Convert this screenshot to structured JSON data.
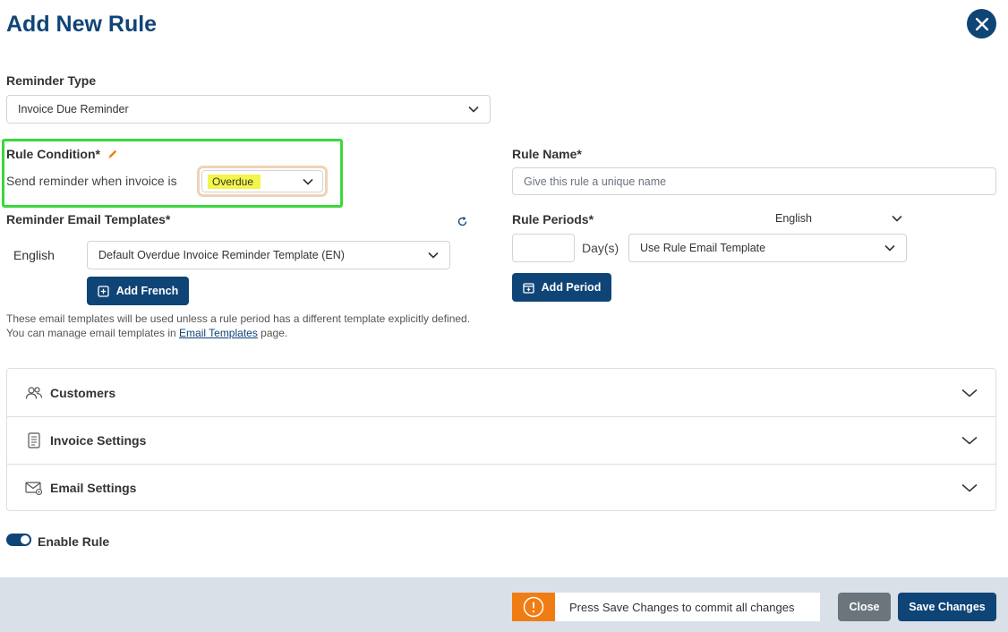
{
  "dialog": {
    "title": "Add New Rule"
  },
  "reminder_type": {
    "label": "Reminder Type",
    "value": "Invoice Due Reminder"
  },
  "rule_condition": {
    "label": "Rule Condition*",
    "prefix": "Send reminder when invoice is",
    "value": "Overdue"
  },
  "rule_name": {
    "label": "Rule Name*",
    "placeholder": "Give this rule a unique name"
  },
  "email_templates": {
    "label": "Reminder Email Templates*",
    "language": "English",
    "template_value": "Default Overdue Invoice Reminder Template (EN)",
    "add_button": "Add French",
    "help_prefix": "These email templates will be used unless a rule period has a different template explicitly defined. You can manage email templates in ",
    "help_link": "Email Templates",
    "help_suffix": " page."
  },
  "rule_periods": {
    "label": "Rule Periods*",
    "language_value": "English",
    "day_value": "",
    "day_unit": "Day(s)",
    "template_value": "Use Rule Email Template",
    "add_button": "Add Period"
  },
  "sections": [
    {
      "label": "Customers",
      "icon": "users-icon"
    },
    {
      "label": "Invoice Settings",
      "icon": "document-icon"
    },
    {
      "label": "Email Settings",
      "icon": "email-icon"
    }
  ],
  "enable_rule": {
    "label": "Enable Rule",
    "enabled": true
  },
  "footer": {
    "notice": "Press Save Changes to commit all changes",
    "close_label": "Close",
    "save_label": "Save Changes"
  },
  "colors": {
    "primary": "#0f4477",
    "accent_orange": "#ef7d14",
    "highlight_green": "#3ad83a",
    "highlight_yellow": "#f4f54a",
    "footer_bg": "#d9e0e7"
  }
}
